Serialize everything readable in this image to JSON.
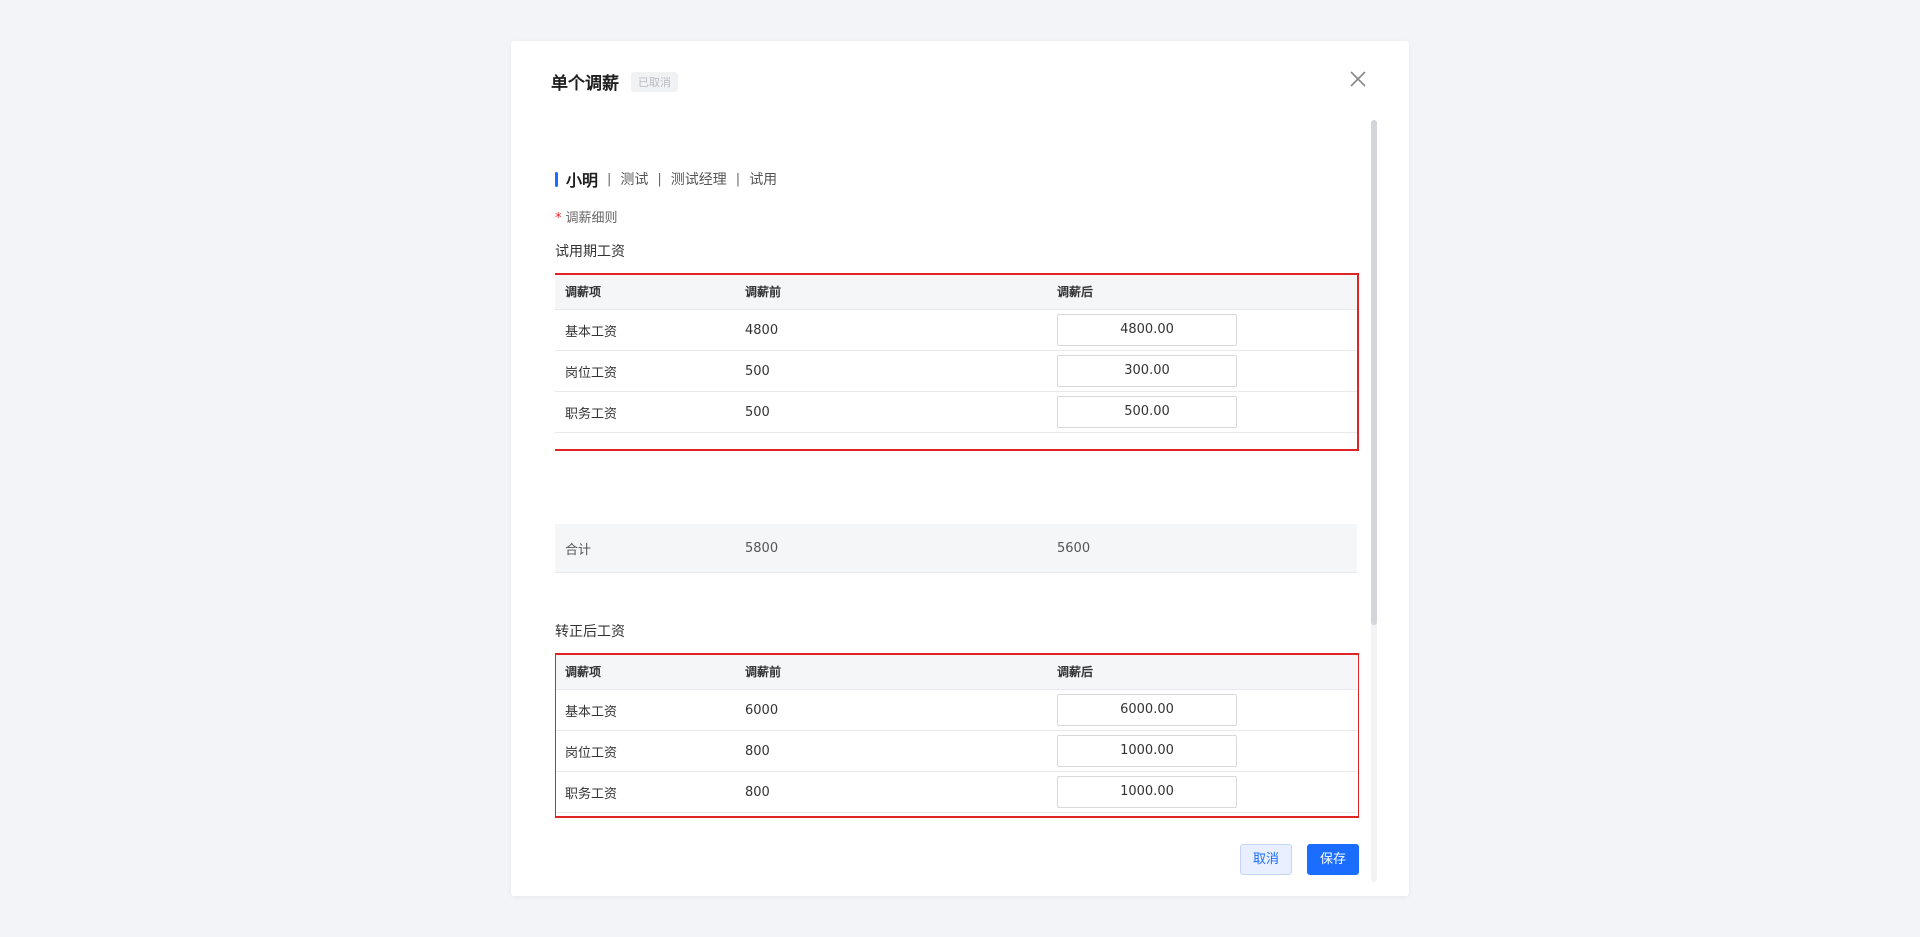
{
  "modal": {
    "title": "单个调薪",
    "status": "已取消"
  },
  "employee": {
    "name": "小明",
    "department": "测试",
    "position": "测试经理",
    "status": "试用",
    "separator": "|"
  },
  "rule": {
    "required_mark": "*",
    "label": "调薪细则"
  },
  "probation": {
    "section_title": "试用期工资",
    "headers": [
      "调薪项",
      "调薪前",
      "调薪后"
    ],
    "rows": [
      {
        "item": "基本工资",
        "before": "4800",
        "after": "4800.00"
      },
      {
        "item": "岗位工资",
        "before": "500",
        "after": "300.00"
      },
      {
        "item": "职务工资",
        "before": "500",
        "after": "500.00"
      }
    ],
    "total": {
      "label": "合计",
      "before": "5800",
      "after": "5600"
    }
  },
  "regular": {
    "section_title": "转正后工资",
    "headers": [
      "调薪项",
      "调薪前",
      "调薪后"
    ],
    "rows": [
      {
        "item": "基本工资",
        "before": "6000",
        "after": "6000.00"
      },
      {
        "item": "岗位工资",
        "before": "800",
        "after": "1000.00"
      },
      {
        "item": "职务工资",
        "before": "800",
        "after": "1000.00"
      }
    ]
  },
  "footer": {
    "cancel_label": "取消",
    "save_label": "保存"
  },
  "colors": {
    "accent": "#1a6dff",
    "highlight": "#e02424",
    "required": "#f5222d"
  }
}
